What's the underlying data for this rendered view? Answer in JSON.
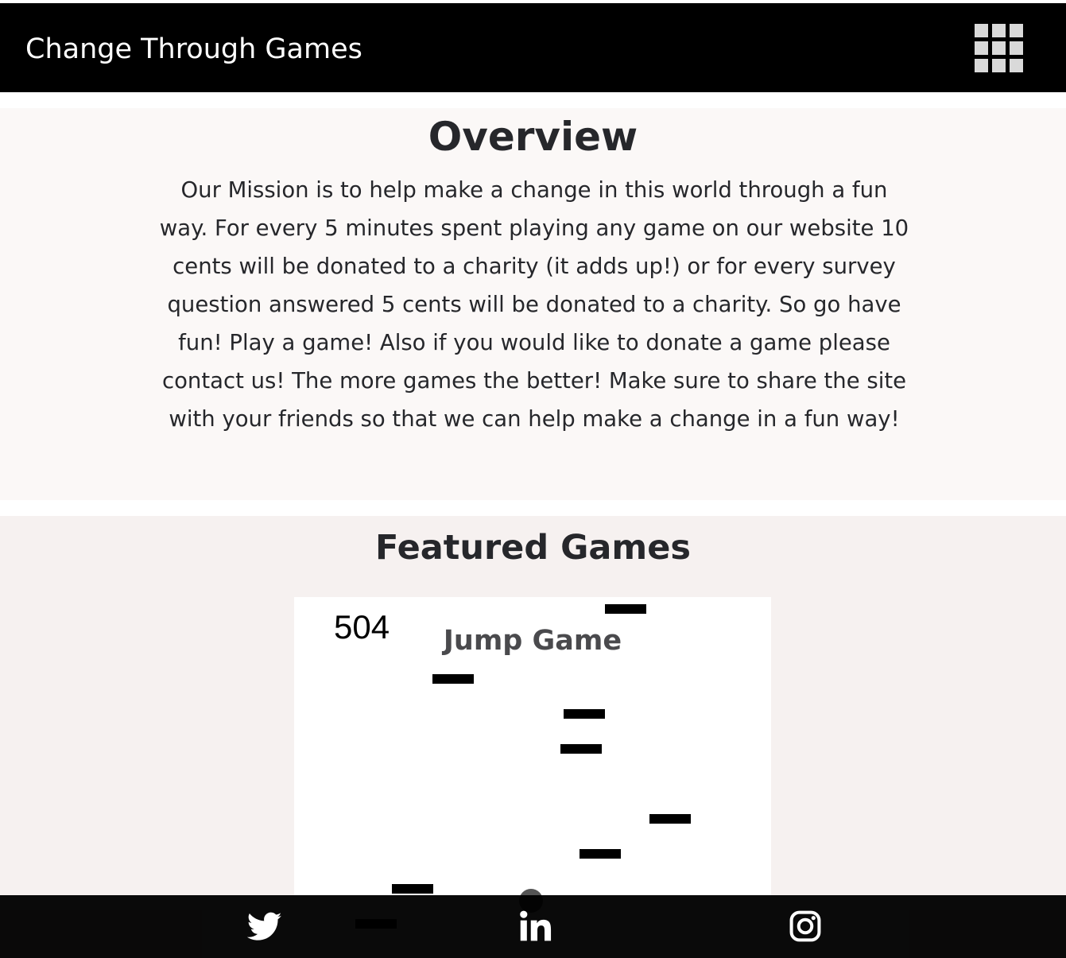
{
  "navbar": {
    "brand": "Change Through Games",
    "menu_icon": "grid-menu-icon"
  },
  "overview": {
    "title": "Overview",
    "text": "Our Mission is to help make a change in this world through a fun way. For every 5 minutes spent playing any game on our website 10 cents will be donated to a charity (it adds up!) or for every survey question answered 5 cents will be donated to a charity. So go have fun! Play a game! Also if you would like to donate a game please contact us! The more games the better! Make sure to share the site with your friends so that we can help make a change in a fun way!"
  },
  "featured": {
    "title": "Featured Games",
    "game": {
      "title": "Jump Game",
      "score": "504"
    }
  },
  "footer": {
    "icons": [
      "twitter-icon",
      "linkedin-icon",
      "instagram-icon"
    ]
  },
  "colors": {
    "navbar_bg": "#000000",
    "overview_bg": "#fbf8f7",
    "featured_bg": "#f6f1f0",
    "text": "#26272b"
  }
}
